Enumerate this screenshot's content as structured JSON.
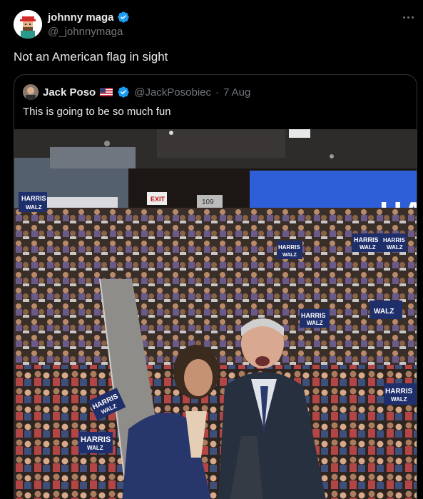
{
  "post": {
    "author_name": "johnny maga",
    "author_handle": "@_johnnymaga",
    "text": "Not an American flag in sight"
  },
  "quoted": {
    "author_name": "Jack Poso",
    "author_handle": "@JackPosobiec",
    "date": "7 Aug",
    "separator": "·",
    "text": "This is going to be so much fun"
  },
  "photo": {
    "signs": [
      "HARRIS",
      "WALZ"
    ],
    "banner": "HAR",
    "exit": "EXIT",
    "section": "109"
  },
  "colors": {
    "background": "#000000",
    "verified": "#1d9bf0",
    "secondary_text": "#71767b",
    "banner_blue": "#2f5fd8",
    "sign_navy": "#1f2f6b"
  },
  "icons": {
    "verified": "verified-badge-icon",
    "more": "more-horizontal-icon",
    "flag": "us-flag-icon"
  }
}
